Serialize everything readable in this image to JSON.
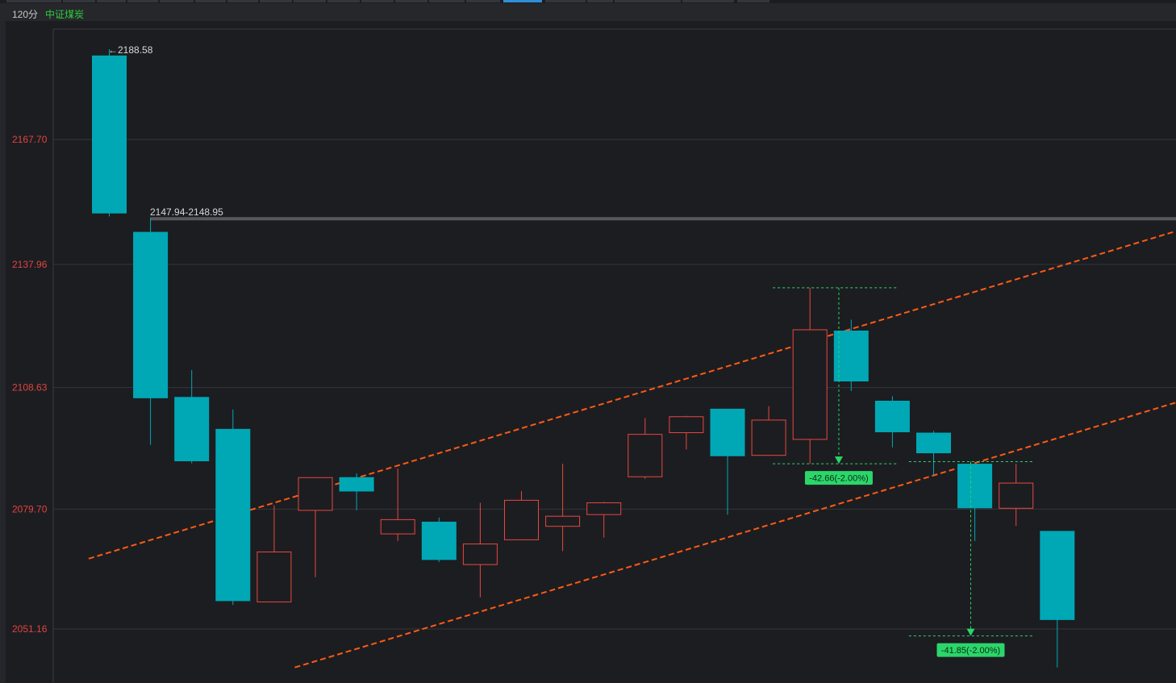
{
  "header": {
    "period": "120分",
    "security_name": "中证煤炭",
    "security_color": "#2ecc40"
  },
  "colors": {
    "background": "#1c1d21",
    "up": "#e8473f",
    "down": "#00a8b6",
    "trendline": "#ff5a14",
    "measure": "#2bd66a",
    "tick_label": "#e0443e"
  },
  "chart_data": {
    "type": "candlestick",
    "y_axis": {
      "ticks": [
        "2167.70",
        "2137.96",
        "2108.63",
        "2079.70",
        "2051.16"
      ],
      "range": [
        2042,
        2196
      ]
    },
    "grid": true,
    "candles": [
      {
        "o": 2187.7,
        "h": 2189.2,
        "l": 2149.4,
        "c": 2150.1
      },
      {
        "o": 2145.7,
        "h": 2148.9,
        "l": 2095.0,
        "c": 2106.1
      },
      {
        "o": 2106.4,
        "h": 2112.8,
        "l": 2090.6,
        "c": 2091.1
      },
      {
        "o": 2098.8,
        "h": 2103.4,
        "l": 2056.9,
        "c": 2057.8
      },
      {
        "o": 2057.6,
        "h": 2080.6,
        "l": 2057.6,
        "c": 2069.5
      },
      {
        "o": 2079.4,
        "h": 2087.2,
        "l": 2063.5,
        "c": 2087.2
      },
      {
        "o": 2087.3,
        "h": 2088.2,
        "l": 2079.4,
        "c": 2083.9
      },
      {
        "o": 2073.8,
        "h": 2089.4,
        "l": 2072.1,
        "c": 2077.2
      },
      {
        "o": 2076.7,
        "h": 2077.7,
        "l": 2067.1,
        "c": 2067.6
      },
      {
        "o": 2066.5,
        "h": 2081.2,
        "l": 2058.7,
        "c": 2071.4
      },
      {
        "o": 2072.4,
        "h": 2084.0,
        "l": 2072.4,
        "c": 2081.8
      },
      {
        "o": 2075.6,
        "h": 2090.5,
        "l": 2069.7,
        "c": 2078.0
      },
      {
        "o": 2078.4,
        "h": 2081.4,
        "l": 2072.9,
        "c": 2081.2
      },
      {
        "o": 2087.4,
        "h": 2101.4,
        "l": 2086.9,
        "c": 2097.5
      },
      {
        "o": 2097.9,
        "h": 2101.9,
        "l": 2093.9,
        "c": 2101.7
      },
      {
        "o": 2103.6,
        "h": 2103.6,
        "l": 2078.4,
        "c": 2092.3
      },
      {
        "o": 2092.5,
        "h": 2104.2,
        "l": 2092.5,
        "c": 2100.9
      },
      {
        "o": 2096.3,
        "h": 2132.4,
        "l": 2090.5,
        "c": 2122.4
      },
      {
        "o": 2122.2,
        "h": 2124.8,
        "l": 2107.8,
        "c": 2110.1
      },
      {
        "o": 2105.5,
        "h": 2106.6,
        "l": 2094.4,
        "c": 2098.0
      },
      {
        "o": 2097.9,
        "h": 2098.3,
        "l": 2087.7,
        "c": 2093.0
      },
      {
        "o": 2090.5,
        "h": 2090.5,
        "l": 2072.1,
        "c": 2079.9
      },
      {
        "o": 2079.9,
        "h": 2090.5,
        "l": 2075.7,
        "c": 2085.9
      },
      {
        "o": 2074.5,
        "h": 2074.5,
        "l": 2042.0,
        "c": 2053.3
      }
    ],
    "annotations": {
      "max_label": "←2188.58",
      "range_label": "2147.94-2148.95",
      "measure_1": "-42.66(-2.00%)",
      "measure_2": "-41.85(-2.00%)"
    },
    "trendlines": [
      {
        "from": [
          -0.5,
          2067.9
        ],
        "to": [
          26.6,
          2148.0
        ]
      },
      {
        "from": [
          4.5,
          2042.0
        ],
        "to": [
          26.6,
          2107.2
        ]
      }
    ],
    "price_line": 2148.95
  }
}
